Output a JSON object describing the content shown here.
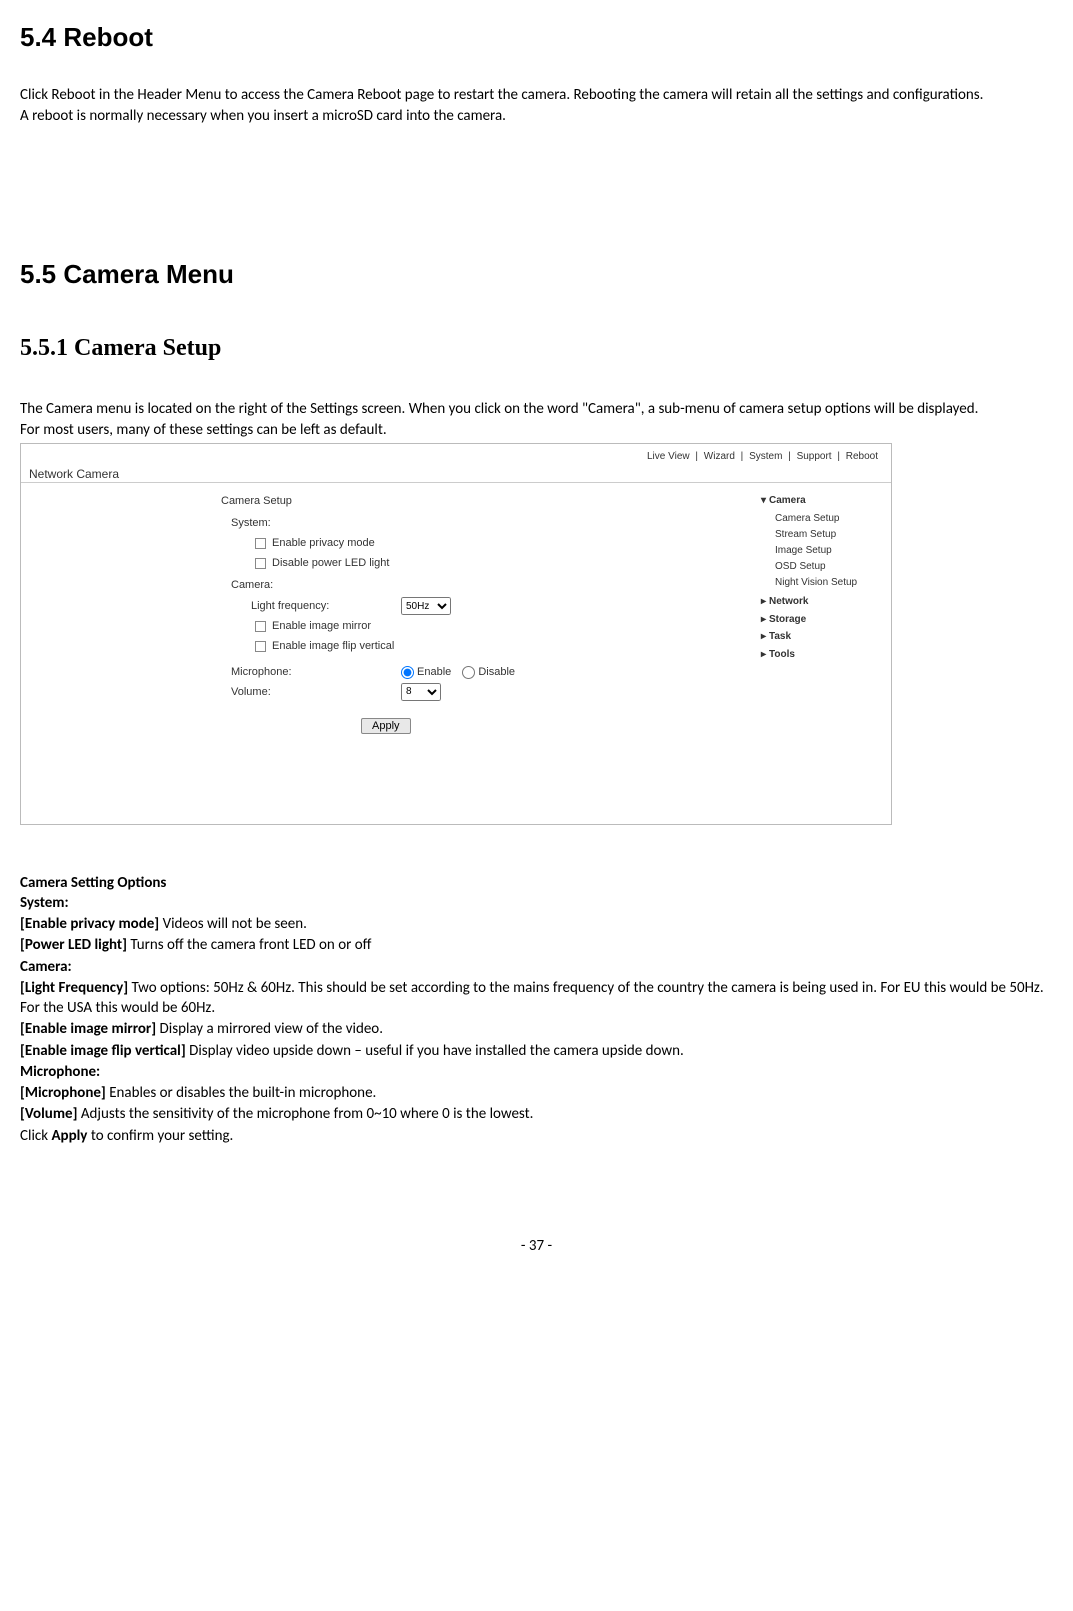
{
  "section_5_4": {
    "title": "5.4 Reboot",
    "p1": "Click Reboot in the Header Menu to access the Camera Reboot page to restart the camera. Rebooting the camera will retain all the settings and configurations.",
    "p2": "A reboot is normally necessary when you insert a microSD card into the camera."
  },
  "section_5_5": {
    "title": "5.5 Camera Menu",
    "sub1_title": "5.5.1 Camera Setup",
    "p1": "The Camera menu is located on the right of the Settings screen. When you click on the word \"Camera\", a sub-menu of camera setup options will be displayed.",
    "p2": "For most users, many of these settings can be left as default."
  },
  "ui": {
    "topnav": [
      "Live View",
      "Wizard",
      "System",
      "Support",
      "Reboot"
    ],
    "app_title": "Network Camera",
    "form": {
      "title": "Camera Setup",
      "system_label": "System:",
      "cb_privacy": "Enable privacy mode",
      "cb_led": "Disable power LED light",
      "camera_label": "Camera:",
      "light_freq_label": "Light frequency:",
      "light_freq_value": "50Hz",
      "cb_mirror": "Enable image mirror",
      "cb_flip": "Enable image flip vertical",
      "mic_label": "Microphone:",
      "mic_enable": "Enable",
      "mic_disable": "Disable",
      "vol_label": "Volume:",
      "vol_value": "8",
      "apply": "Apply"
    },
    "sidebar": {
      "camera": "Camera",
      "subs": [
        "Camera Setup",
        "Stream Setup",
        "Image Setup",
        "OSD Setup",
        "Night Vision Setup"
      ],
      "network": "Network",
      "storage": "Storage",
      "task": "Task",
      "tools": "Tools"
    }
  },
  "options": {
    "heading": "Camera Setting Options",
    "system": "System:",
    "privacy_k": "[Enable privacy mode]",
    "privacy_v": " Videos will not be seen.",
    "led_k": "[Power LED light]",
    "led_v": " Turns off the camera front LED on or off",
    "camera": "Camera:",
    "freq_k": "[Light Frequency]",
    "freq_v": " Two options: 50Hz & 60Hz. This should be set according to the mains frequency of the country the camera is being used in. For EU this would be 50Hz. For the USA this would be 60Hz.",
    "mirror_k": "[Enable image mirror]",
    "mirror_v": " Display a mirrored view of the video.",
    "flip_k": "[Enable image flip vertical]",
    "flip_v": " Display video upside down – useful if you have installed the camera upside down.",
    "mic": "Microphone:",
    "mic_k": "[Microphone]",
    "mic_v": " Enables or disables the built-in microphone.",
    "vol_k": "[Volume]",
    "vol_v": " Adjusts the sensitivity of the microphone from 0~10 where 0 is the lowest.",
    "apply_pre": "Click ",
    "apply_b": "Apply",
    "apply_post": " to confirm your setting."
  },
  "page_number": "- 37 -"
}
